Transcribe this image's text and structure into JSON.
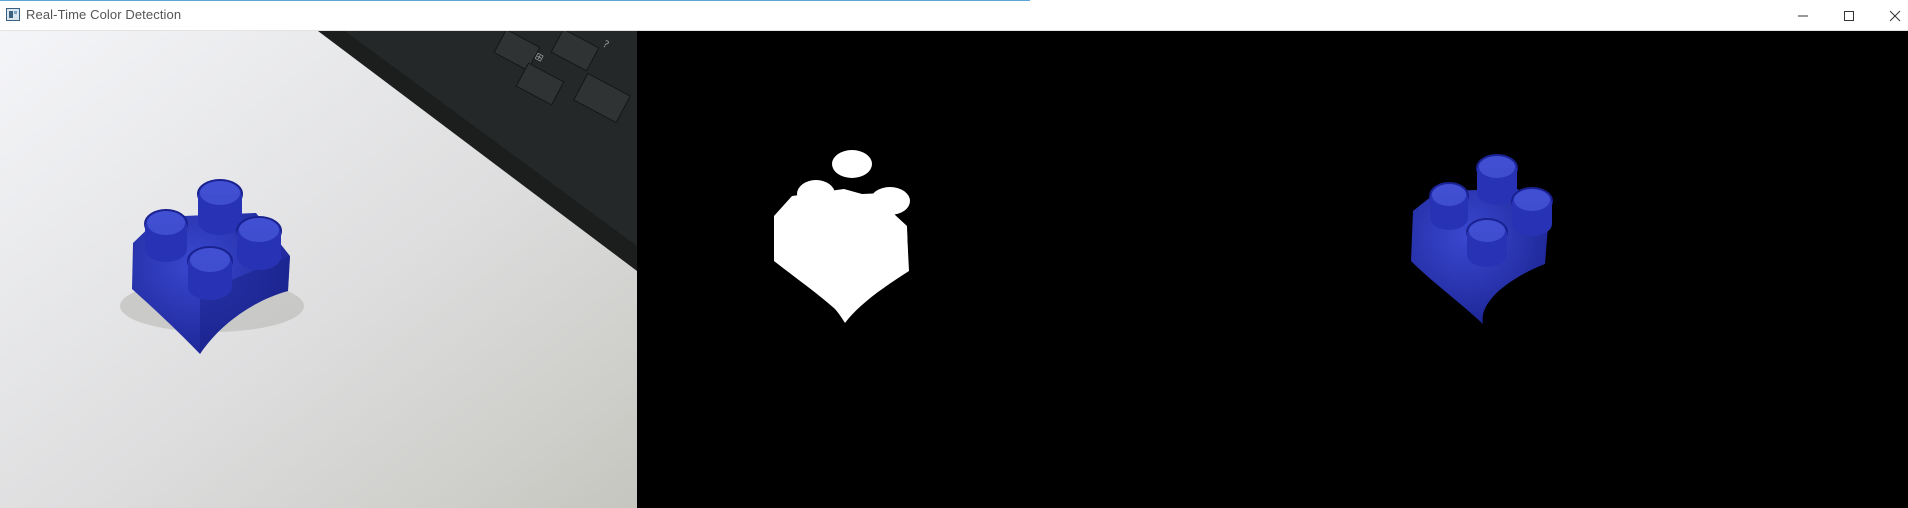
{
  "window": {
    "title": "Real-Time Color Detection",
    "controls": {
      "minimize": "minimize-icon",
      "maximize": "maximize-icon",
      "close": "close-icon"
    }
  },
  "panes": [
    {
      "name": "original-camera-frame",
      "content": "blue toy brick on white desk with keyboard corner"
    },
    {
      "name": "binary-mask",
      "content": "white silhouette of detected object on black"
    },
    {
      "name": "masked-result",
      "content": "blue toy brick isolated on black"
    }
  ],
  "colors": {
    "detected": "#2a35b8",
    "mask": "#ffffff",
    "background": "#000000",
    "titlebar": "#ffffff"
  }
}
